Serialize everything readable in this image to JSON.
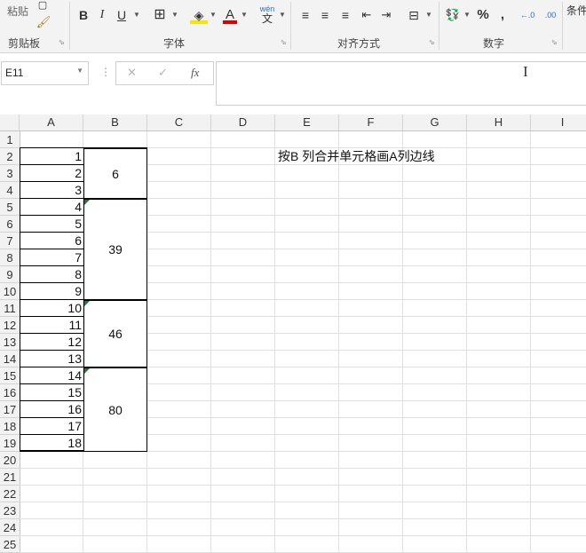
{
  "ribbon": {
    "paste_label": "粘贴",
    "groups": {
      "clipboard": "剪贴板",
      "font": "字体",
      "align": "对齐方式",
      "number": "数字"
    },
    "font_buttons": {
      "bold": "B",
      "italic": "I",
      "underline": "U",
      "font_color": "A",
      "wen": "wén",
      "wen_char": "文"
    },
    "number_buttons": {
      "percent": "%",
      "comma": ","
    },
    "cond_label": "条件"
  },
  "formula_bar": {
    "name_box": "E11",
    "cancel": "✕",
    "enter": "✓",
    "fx": "fx"
  },
  "columns": [
    "A",
    "B",
    "C",
    "D",
    "E",
    "F",
    "G",
    "H",
    "I"
  ],
  "rows": [
    "1",
    "2",
    "3",
    "4",
    "5",
    "6",
    "7",
    "8",
    "9",
    "10",
    "11",
    "12",
    "13",
    "14",
    "15",
    "16",
    "17",
    "18",
    "19",
    "20",
    "21",
    "22",
    "23",
    "24",
    "25"
  ],
  "sheet": {
    "col_a": [
      "1",
      "2",
      "3",
      "4",
      "5",
      "6",
      "7",
      "8",
      "9",
      "10",
      "11",
      "12",
      "13",
      "14",
      "15",
      "16",
      "17",
      "18"
    ],
    "merged_b": [
      "6",
      "39",
      "46",
      "80"
    ],
    "note": "按B 列合并单元格画A列边线"
  }
}
